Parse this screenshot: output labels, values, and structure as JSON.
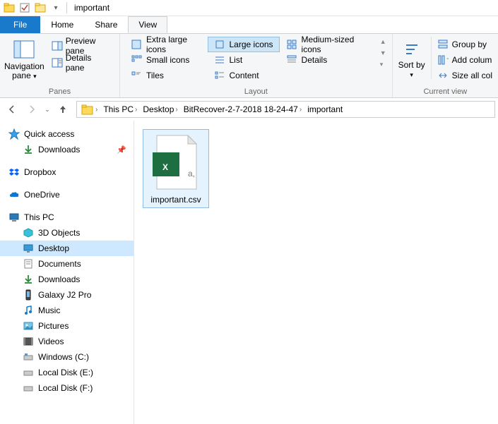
{
  "title": "important",
  "tabs": {
    "file": "File",
    "home": "Home",
    "share": "Share",
    "view": "View"
  },
  "panes": {
    "label": "Panes",
    "navigation": "Navigation pane",
    "preview": "Preview pane",
    "details": "Details pane"
  },
  "layout": {
    "label": "Layout",
    "extra_large": "Extra large icons",
    "large": "Large icons",
    "medium": "Medium-sized icons",
    "small": "Small icons",
    "list": "List",
    "details": "Details",
    "tiles": "Tiles",
    "content": "Content"
  },
  "sort": {
    "label": "Sort by"
  },
  "current_view": {
    "label": "Current view",
    "group_by": "Group by",
    "add_columns": "Add colum",
    "size_all": "Size all col"
  },
  "breadcrumb": [
    "This PC",
    "Desktop",
    "BitRecover-2-7-2018 18-24-47",
    "important"
  ],
  "sidebar": {
    "quick_access": "Quick access",
    "downloads": "Downloads",
    "dropbox": "Dropbox",
    "onedrive": "OneDrive",
    "this_pc": "This PC",
    "children": {
      "objects3d": "3D Objects",
      "desktop": "Desktop",
      "documents": "Documents",
      "downloads": "Downloads",
      "galaxy": "Galaxy J2 Pro",
      "music": "Music",
      "pictures": "Pictures",
      "videos": "Videos",
      "c": "Windows (C:)",
      "e": "Local Disk (E:)",
      "f": "Local Disk (F:)"
    }
  },
  "file": {
    "name": "important.csv"
  }
}
